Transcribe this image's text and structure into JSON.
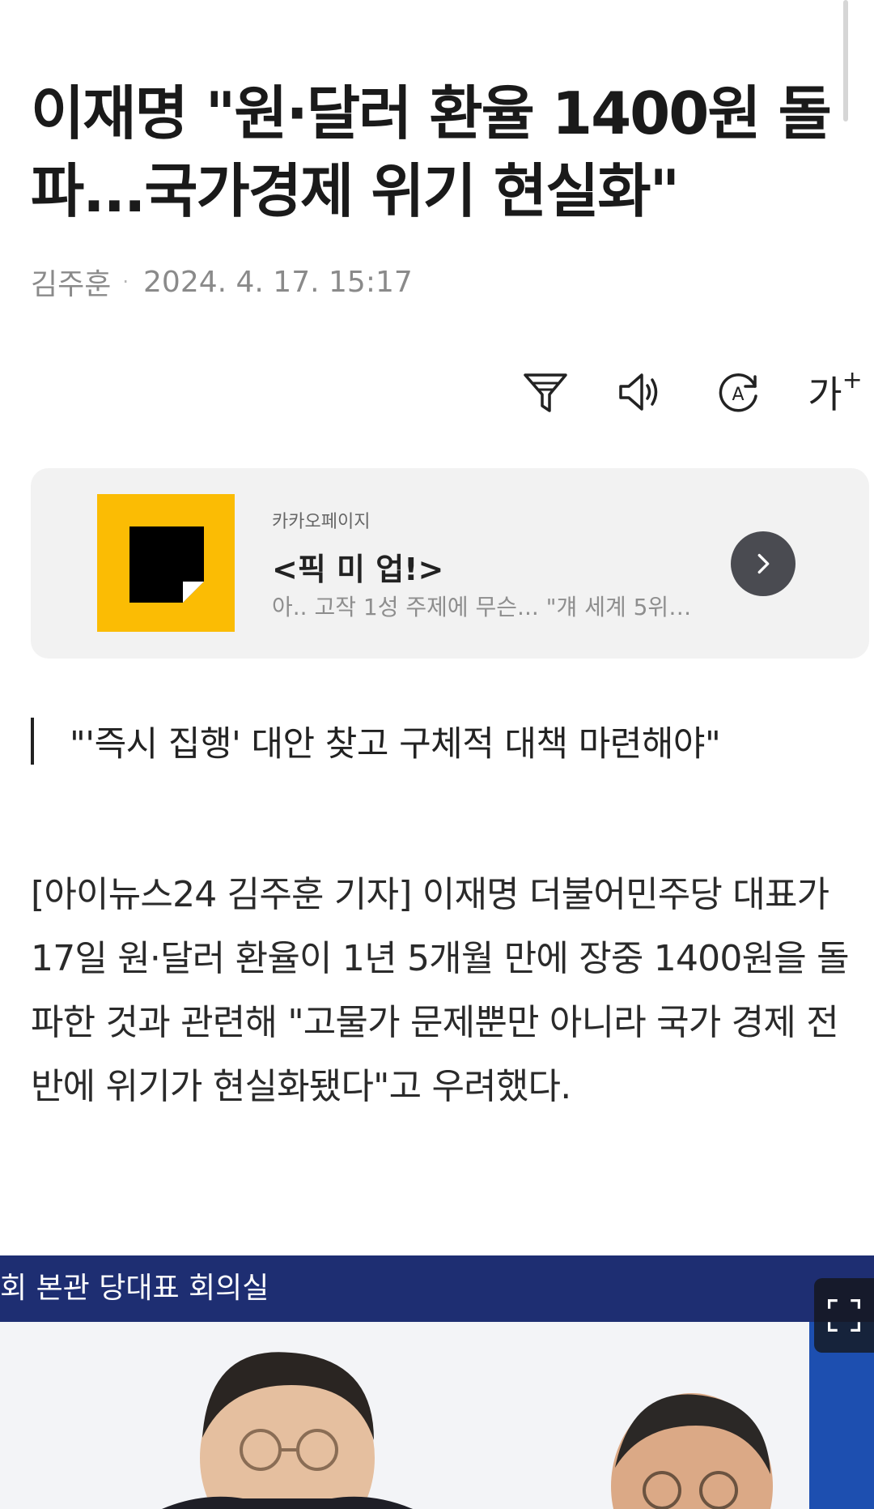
{
  "article": {
    "headline": "이재명 \"원·달러 환율 1400원 돌파...국가경제 위기 현실화\"",
    "author": "김주훈",
    "separator": "·",
    "datetime": "2024. 4. 17. 15:17"
  },
  "toolbar": {
    "items": [
      {
        "icon": "filter-icon"
      },
      {
        "icon": "speaker-icon"
      },
      {
        "icon": "translate-icon"
      },
      {
        "icon": "font-size-icon",
        "label": "가",
        "sup": "+"
      }
    ]
  },
  "promo": {
    "source": "카카오페이지",
    "title": "<픽 미 업!>",
    "description": "아.. 고작 1성 주제에 무슨... \"걔 세계 5위…",
    "logo_color": "#fbbc04",
    "arrow_icon": "chevron-right-icon"
  },
  "subheadline": "\"'즉시 집행' 대안 찾고 구체적 대책 마련해야\"",
  "body": "[아이뉴스24 김주훈 기자] 이재명 더불어민주당 대표가 17일 원·달러 환율이 1년 5개월 만에 장중 1400원을 돌파한 것과 관련해 \"고물가 문제뿐만 아니라 국가 경제 전반에 위기가 현실화됐다\"고 우려했다.",
  "photo": {
    "caption": "회 본관 당대표 회의실",
    "expand_icon": "expand-icon",
    "banner_color": "#1e2e72"
  }
}
